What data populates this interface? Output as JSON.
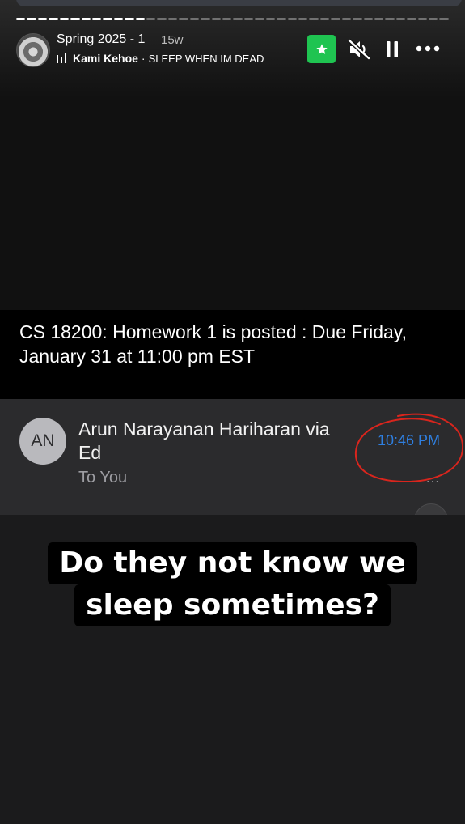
{
  "story": {
    "title": "Spring 2025 - 1",
    "time_ago": "15w",
    "music": {
      "artist": "Kami Kehoe",
      "separator": "·",
      "song": "SLEEP WHEN IM DEAD"
    },
    "progress_segments_total": 40,
    "progress_segments_done": 12
  },
  "icons": {
    "star": "star-icon",
    "mute": "speaker-muted-icon",
    "pause": "pause-icon",
    "more": "more-icon",
    "music": "music-bars-icon"
  },
  "colors": {
    "star_button": "#1fc451",
    "time_link": "#2f7fe0",
    "annotation": "#d9251d"
  },
  "email": {
    "subject": "CS 18200: Homework 1 is posted : Due Friday, January 31 at 11:00 pm EST",
    "sender_initials": "AN",
    "sender_name": "Arun Narayanan Hariharan via Ed",
    "recipient": "To You",
    "time": "10:46 PM",
    "more": "…"
  },
  "caption": {
    "line1": "Do they not know we",
    "line2": "sleep sometimes?"
  }
}
